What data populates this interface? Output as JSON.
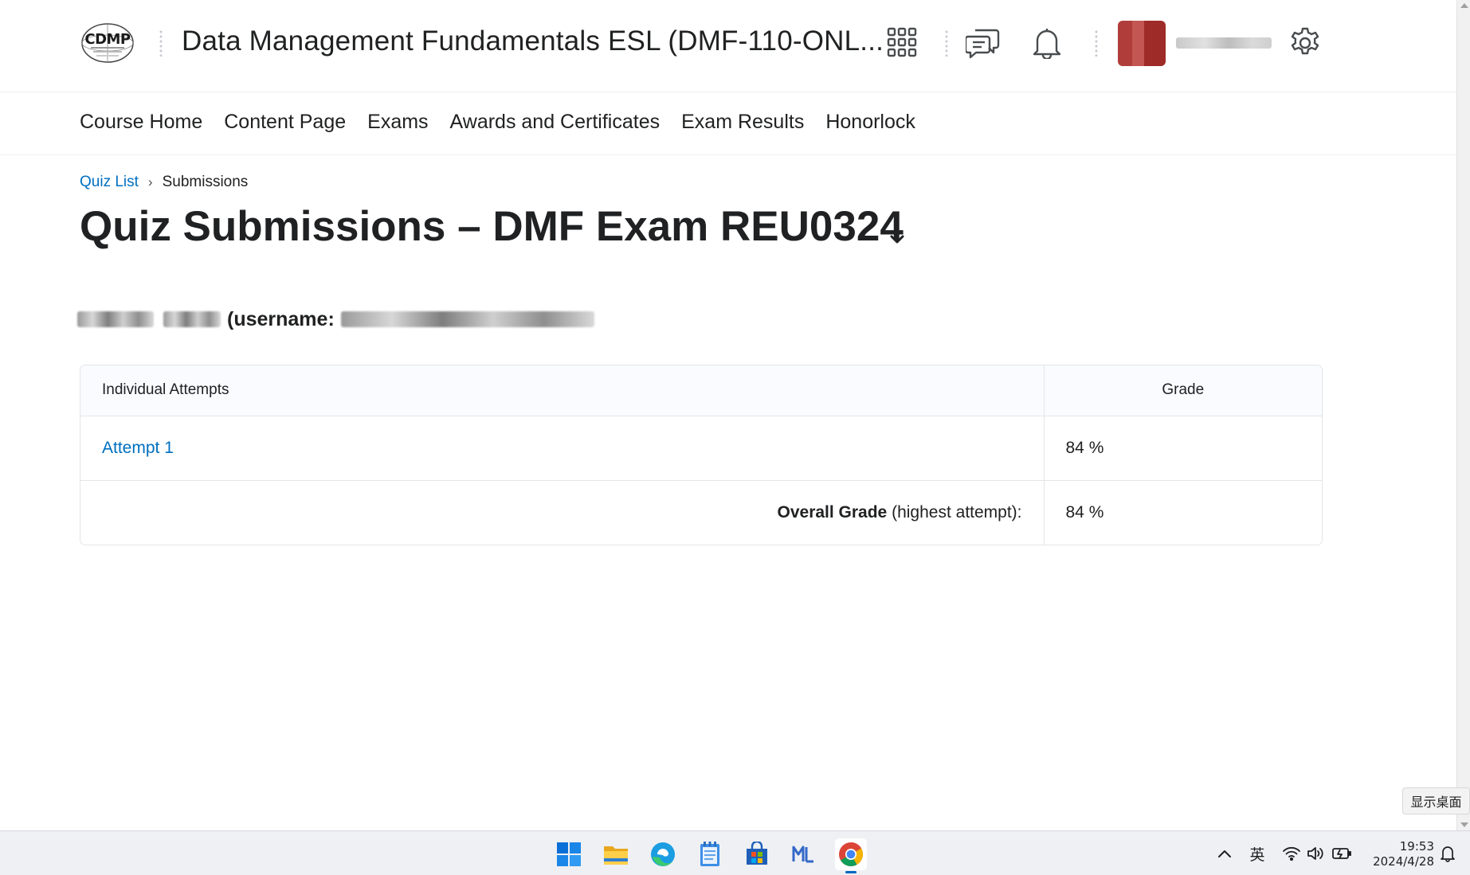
{
  "header": {
    "logo_text": "CDMP",
    "course_title": "Data Management Fundamentals ESL (DMF-110-ONL...",
    "icons": [
      "apps-grid-icon",
      "chat-icon",
      "bell-icon",
      "gear-icon"
    ]
  },
  "nav": {
    "items": [
      "Course Home",
      "Content Page",
      "Exams",
      "Awards and Certificates",
      "Exam Results",
      "Honorlock"
    ]
  },
  "breadcrumb": {
    "link": "Quiz List",
    "separator": "›",
    "current": "Submissions"
  },
  "page": {
    "title": "Quiz Submissions – DMF Exam REU0324",
    "username_label": "(username:"
  },
  "table": {
    "headers": [
      "Individual Attempts",
      "Grade"
    ],
    "rows": [
      {
        "attempt": "Attempt 1",
        "grade": "84 %"
      }
    ],
    "overall_label": "Overall Grade",
    "overall_note": "(highest attempt):",
    "overall_grade": "84 %"
  },
  "taskbar": {
    "apps": [
      "windows-start-icon",
      "file-explorer-icon",
      "edge-browser-icon",
      "notepad-icon",
      "microsoft-store-icon",
      "mail-app-icon",
      "chrome-browser-icon"
    ],
    "ime": "英",
    "time": "19:53",
    "date": "2024/4/28",
    "show_desktop_tooltip": "显示桌面"
  },
  "colors": {
    "link": "#006fbf",
    "avatar": "#a8322e",
    "taskbar_bg": "#eef0f4"
  }
}
